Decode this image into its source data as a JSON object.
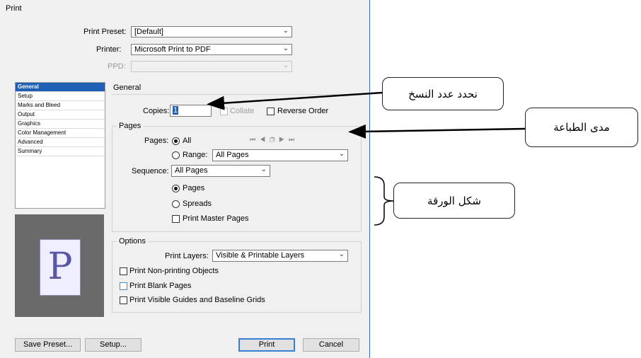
{
  "dialog": {
    "title": "Print"
  },
  "top": {
    "preset_label": "Print Preset:",
    "preset_value": "[Default]",
    "printer_label": "Printer:",
    "printer_value": "Microsoft Print to PDF",
    "ppd_label": "PPD:",
    "ppd_value": ""
  },
  "sidebar": {
    "items": [
      "General",
      "Setup",
      "Marks and Bleed",
      "Output",
      "Graphics",
      "Color Management",
      "Advanced",
      "Summary"
    ],
    "selected_index": 0
  },
  "preview": {
    "letter": "P"
  },
  "general": {
    "heading": "General",
    "copies_label": "Copies:",
    "copies_value": "1",
    "collate_label": "Collate",
    "reverse_label": "Reverse Order"
  },
  "pages": {
    "group_title": "Pages",
    "pages_label": "Pages:",
    "all_label": "All",
    "range_label": "Range:",
    "range_value": "All Pages",
    "sequence_label": "Sequence:",
    "sequence_value": "All Pages",
    "pages_option": "Pages",
    "spreads_option": "Spreads",
    "master_label": "Print Master Pages",
    "nav_icons": [
      "first-page-icon",
      "prev-page-icon",
      "spread-icon",
      "next-page-icon",
      "last-page-icon"
    ]
  },
  "options": {
    "group_title": "Options",
    "layers_label": "Print Layers:",
    "layers_value": "Visible & Printable Layers",
    "nonprinting_label": "Print Non-printing Objects",
    "blank_label": "Print Blank Pages",
    "guides_label": "Print Visible Guides and Baseline Grids"
  },
  "buttons": {
    "save_preset": "Save Preset...",
    "setup": "Setup...",
    "print": "Print",
    "cancel": "Cancel"
  },
  "annotations": {
    "copies_note": "نحدد عدد النسخ",
    "range_note": "مدى الطباعة",
    "paper_note": "شكل الورقة"
  },
  "colors": {
    "selection": "#1f5fb5",
    "dialog_bg": "#f0f0f0",
    "accent_line": "#3a6fc0"
  }
}
